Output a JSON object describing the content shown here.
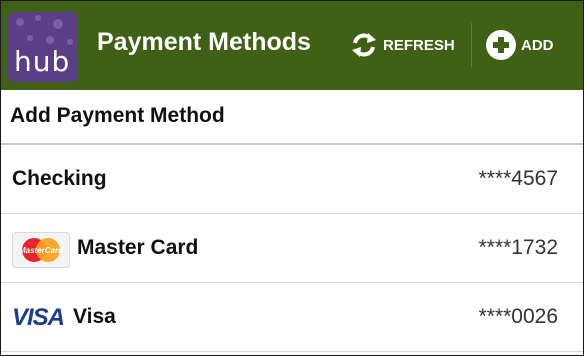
{
  "app": {
    "logo_text": "hub",
    "title": "Payment Methods"
  },
  "actions": {
    "refresh_label": "REFRESH",
    "add_label": "ADD"
  },
  "section": {
    "header": "Add Payment Method"
  },
  "payment_methods": [
    {
      "name": "Checking",
      "number": "****4567",
      "icon": "none"
    },
    {
      "name": "Master Card",
      "number": "****1732",
      "icon": "mastercard-icon"
    },
    {
      "name": "Visa",
      "number": "****0026",
      "icon": "visa-icon",
      "icon_text": "VISA"
    }
  ],
  "colors": {
    "action_bar": "#3e6116",
    "logo_bg": "#5b3f86",
    "visa_blue": "#1a3e8c",
    "mastercard_red": "#e8252b",
    "mastercard_orange": "#f7a11a"
  }
}
